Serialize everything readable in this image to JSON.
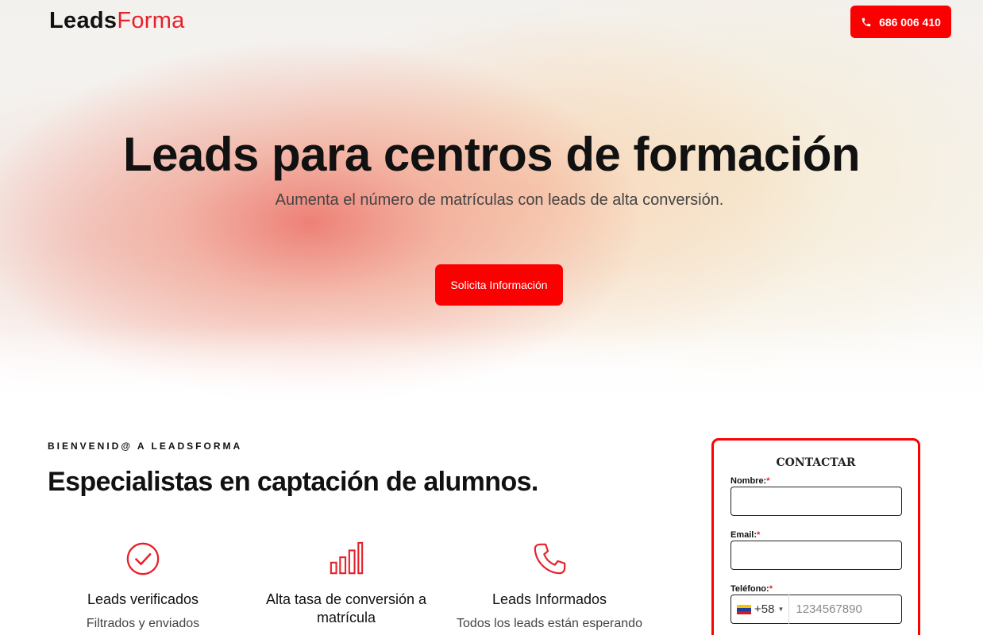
{
  "header": {
    "logo_part1": "Leads",
    "logo_part2": "Forma",
    "phone_label": "686 006 410"
  },
  "hero": {
    "title": "Leads para centros de formación",
    "subtitle": "Aumenta el número de matrículas con leads de alta conversión.",
    "cta_label": "Solicita Información"
  },
  "intro": {
    "eyebrow": "BIENVENID@ A LEADSFORMA",
    "title": "Especialistas en captación de alumnos."
  },
  "features": [
    {
      "icon": "check-circle-icon",
      "title": "Leads verificados",
      "desc": "Filtrados y enviados"
    },
    {
      "icon": "bar-chart-icon",
      "title": "Alta tasa de conversión a matrícula",
      "desc": ""
    },
    {
      "icon": "phone-icon",
      "title": "Leads Informados",
      "desc": "Todos los leads están esperando"
    }
  ],
  "form": {
    "title": "CONTACTAR",
    "name_label": "Nombre:",
    "email_label": "Email:",
    "phone_label": "Teléfono:",
    "required_mark": "*",
    "phone_code": "+58",
    "phone_placeholder": "1234567890"
  },
  "colors": {
    "accent": "#fb0000",
    "logo_accent": "#e8202a"
  }
}
